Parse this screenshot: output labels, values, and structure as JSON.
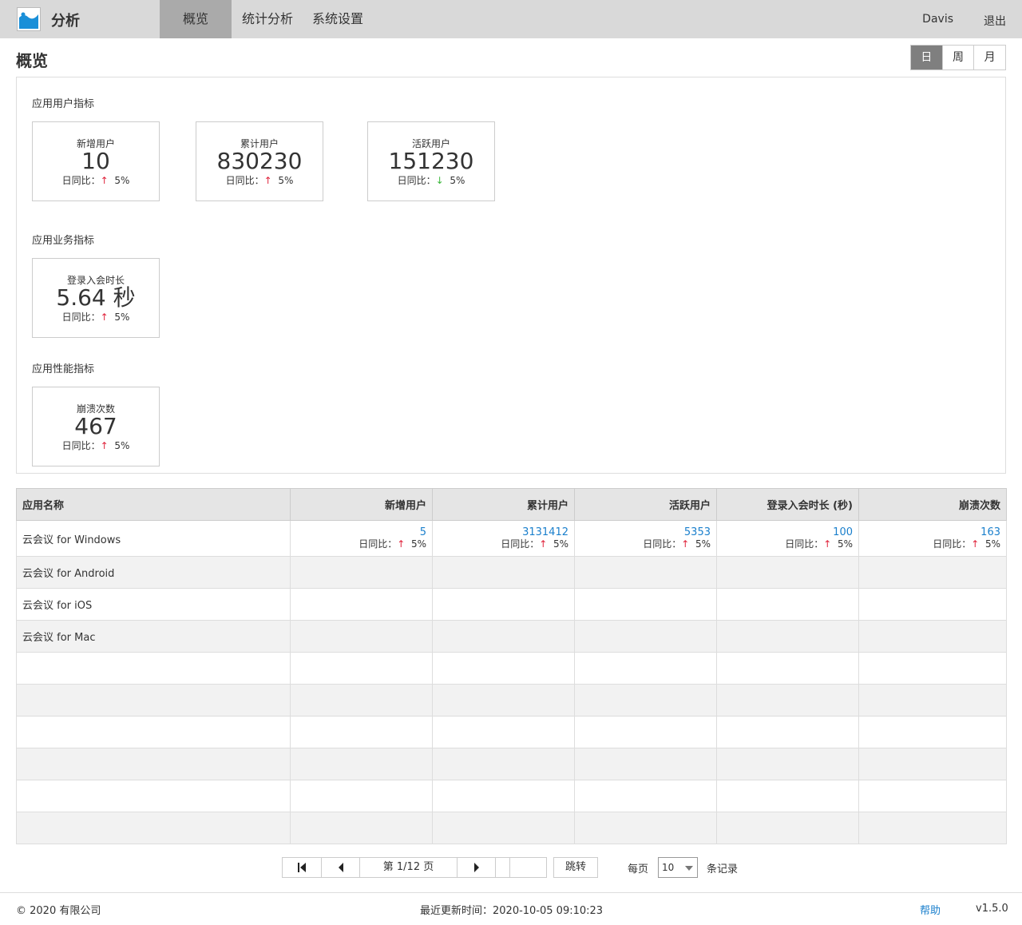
{
  "header": {
    "app_name": "分析",
    "nav": [
      {
        "label": "概览",
        "active": true
      },
      {
        "label": "统计分析",
        "active": false
      },
      {
        "label": "系统设置",
        "active": false
      }
    ],
    "user": "Davis",
    "logout": "退出"
  },
  "page": {
    "title": "概览",
    "period_tabs": [
      "日",
      "周",
      "月"
    ],
    "period_active": "日"
  },
  "sections": {
    "user_metrics": {
      "title": "应用用户指标",
      "cards": [
        {
          "label": "新增用户",
          "value": "10",
          "cmp_label": "日同比：",
          "trend": "up",
          "pct": "5%"
        },
        {
          "label": "累计用户",
          "value": "830230",
          "cmp_label": "日同比：",
          "trend": "up",
          "pct": "5%"
        },
        {
          "label": "活跃用户",
          "value": "151230",
          "cmp_label": "日同比：",
          "trend": "down",
          "pct": "5%"
        }
      ]
    },
    "business_metrics": {
      "title": "应用业务指标",
      "cards": [
        {
          "label": "登录入会时长",
          "value": "5.64 秒",
          "cmp_label": "日同比：",
          "trend": "up",
          "pct": "5%"
        }
      ]
    },
    "performance_metrics": {
      "title": "应用性能指标",
      "cards": [
        {
          "label": "崩溃次数",
          "value": "467",
          "cmp_label": "日同比：",
          "trend": "up",
          "pct": "5%"
        }
      ]
    }
  },
  "arrows": {
    "up": "↑",
    "down": "↓"
  },
  "table": {
    "headers": [
      "应用名称",
      "新增用户",
      "累计用户",
      "活跃用户",
      "登录入会时长 (秒)",
      "崩溃次数"
    ],
    "rows": [
      {
        "name": "云会议 for Windows",
        "cells": [
          {
            "value": "5",
            "cmp_label": "日同比：",
            "trend": "up",
            "pct": "5%"
          },
          {
            "value": "3131412",
            "cmp_label": "日同比：",
            "trend": "up",
            "pct": "5%"
          },
          {
            "value": "5353",
            "cmp_label": "日同比：",
            "trend": "up",
            "pct": "5%"
          },
          {
            "value": "100",
            "cmp_label": "日同比：",
            "trend": "up",
            "pct": "5%"
          },
          {
            "value": "163",
            "cmp_label": "日同比：",
            "trend": "up",
            "pct": "5%"
          }
        ]
      },
      {
        "name": "云会议 for Android",
        "cells": []
      },
      {
        "name": "云会议 for iOS",
        "cells": []
      },
      {
        "name": "云会议 for Mac",
        "cells": []
      },
      {
        "name": "",
        "cells": []
      },
      {
        "name": "",
        "cells": []
      },
      {
        "name": "",
        "cells": []
      },
      {
        "name": "",
        "cells": []
      },
      {
        "name": "",
        "cells": []
      },
      {
        "name": "",
        "cells": []
      }
    ]
  },
  "pagination": {
    "page_info": "第 1/12 页",
    "jump_value": "",
    "jump_label": "跳转",
    "per_page_label": "每页",
    "per_page_value": "10",
    "records_label": "条记录"
  },
  "footer": {
    "copyright": "© 2020 有限公司",
    "updated": "最近更新时间：2020-10-05 09:10:23",
    "help": "帮助",
    "version": "v1.5.0"
  },
  "colors": {
    "header_bg": "#d9d9d9",
    "nav_active_bg": "#aaaaaa",
    "link_blue": "#1a7fcc",
    "up_red": "#e0233b",
    "down_green": "#3cb73c",
    "logo_blue": "#1a8fd8"
  }
}
